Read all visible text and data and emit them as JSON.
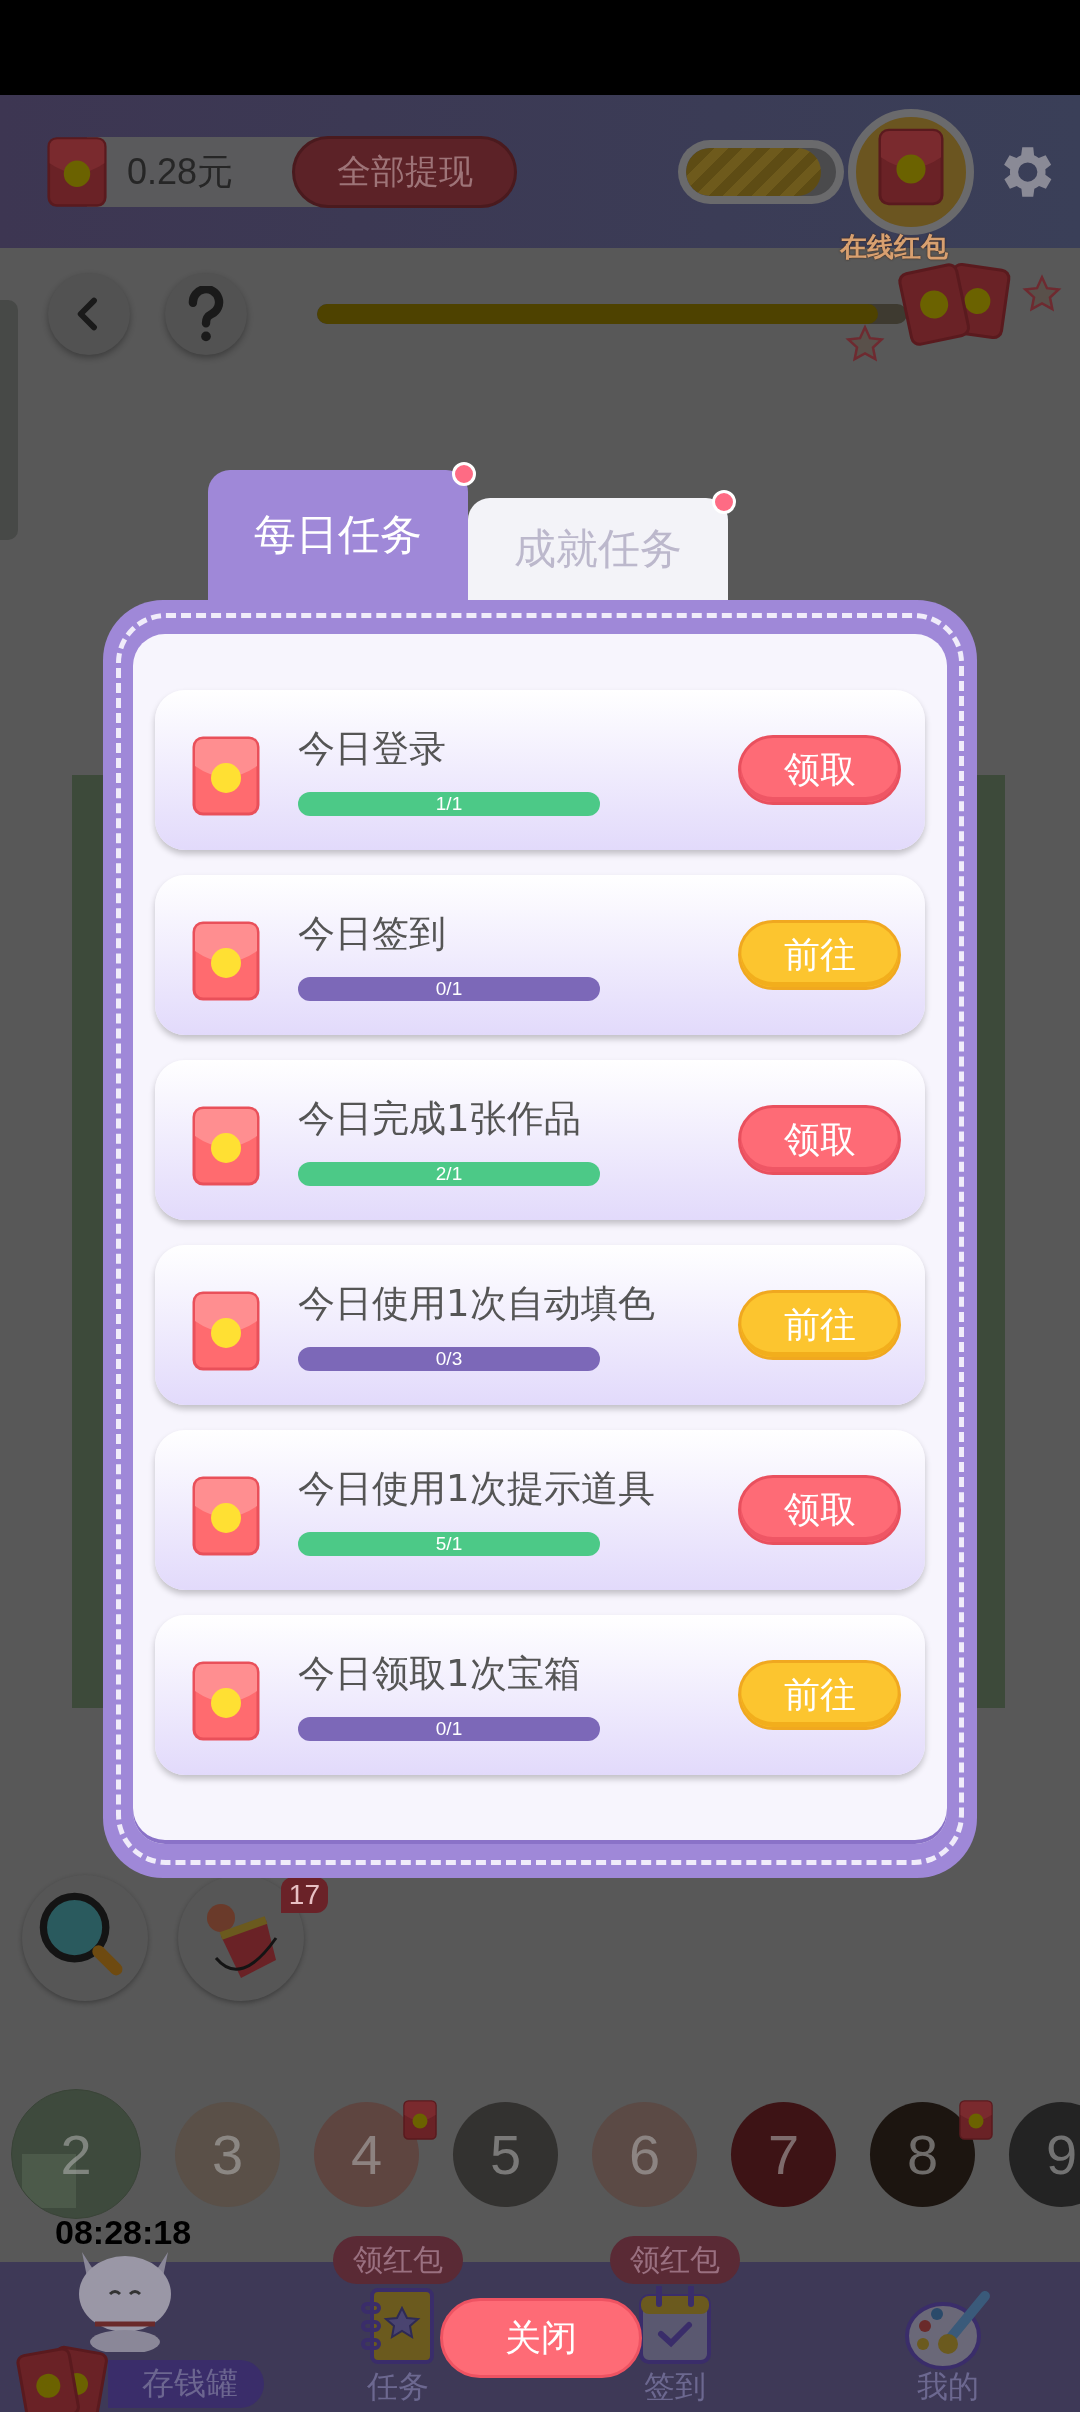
{
  "header": {
    "balance": "0.28元",
    "withdraw_button": "全部提现",
    "bonus_progress": {
      "level": 0.9
    },
    "online_bonus_label": "在线红包"
  },
  "level_progress": {
    "level": 0.95
  },
  "tabs": [
    {
      "label": "每日任务",
      "selected": true,
      "has_dot": true
    },
    {
      "label": "成就任务",
      "selected": false,
      "has_dot": true
    }
  ],
  "tasks": [
    {
      "title": "今日登录",
      "progress": "1/1",
      "completed": true,
      "action": {
        "kind": "claim",
        "label": "领取"
      }
    },
    {
      "title": "今日签到",
      "progress": "0/1",
      "completed": false,
      "action": {
        "kind": "go",
        "label": "前往"
      }
    },
    {
      "title": "今日完成1张作品",
      "progress": "2/1",
      "completed": true,
      "action": {
        "kind": "claim",
        "label": "领取"
      }
    },
    {
      "title": "今日使用1次自动填色",
      "progress": "0/3",
      "completed": false,
      "action": {
        "kind": "go",
        "label": "前往"
      }
    },
    {
      "title": "今日使用1次提示道具",
      "progress": "5/1",
      "completed": true,
      "action": {
        "kind": "claim",
        "label": "领取"
      }
    },
    {
      "title": "今日领取1次宝箱",
      "progress": "0/1",
      "completed": false,
      "action": {
        "kind": "go",
        "label": "前往"
      }
    }
  ],
  "tools": [
    {
      "kind": "magnifier"
    },
    {
      "kind": "paint_bucket",
      "badge": "17"
    }
  ],
  "palette": [
    {
      "number": "2",
      "color": "#3e4a3d",
      "selected": true,
      "has_redpacket": false
    },
    {
      "number": "3",
      "color": "#5a5048",
      "selected": false,
      "has_redpacket": false
    },
    {
      "number": "4",
      "color": "#5e4540",
      "selected": false,
      "has_redpacket": true
    },
    {
      "number": "5",
      "color": "#333230",
      "selected": false,
      "has_redpacket": false
    },
    {
      "number": "6",
      "color": "#5b4a45",
      "selected": false,
      "has_redpacket": false
    },
    {
      "number": "7",
      "color": "#3d1315",
      "selected": false,
      "has_redpacket": false
    },
    {
      "number": "8",
      "color": "#1c1510",
      "selected": false,
      "has_redpacket": true
    },
    {
      "number": "9",
      "color": "#232323",
      "selected": false,
      "has_redpacket": false
    }
  ],
  "timer": "08:28:18",
  "nav": {
    "piggy_bank": "存钱罐",
    "items": [
      {
        "kind": "tasks",
        "label": "任务",
        "tag": "领红包"
      },
      {
        "kind": "checkin",
        "label": "签到",
        "tag": "领红包"
      },
      {
        "kind": "profile",
        "label": "我的"
      }
    ]
  },
  "close_button": "关闭"
}
